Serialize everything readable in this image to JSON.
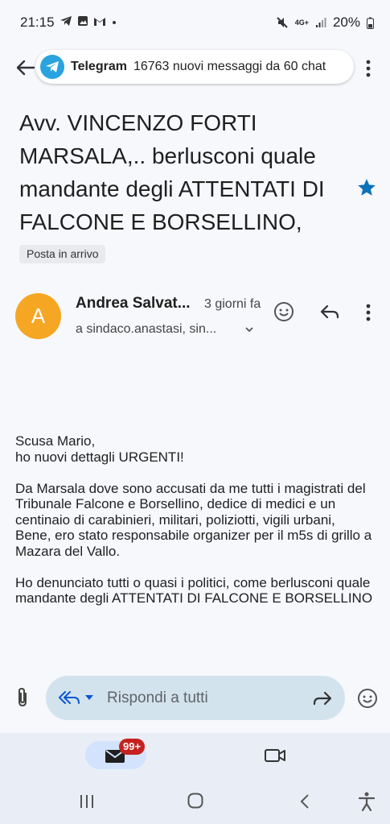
{
  "status_bar": {
    "time": "21:15",
    "network": "4G+",
    "battery": "20%",
    "left_icons": [
      "telegram-icon",
      "image-icon",
      "gmail-icon",
      "dot-icon"
    ],
    "right_icons": [
      "mute-icon",
      "signal-icon",
      "battery-icon"
    ]
  },
  "notification": {
    "app": "Telegram",
    "message": "16763 nuovi messaggi da 60 chat"
  },
  "email": {
    "subject": "Avv. VINCENZO FORTI MARSALA,.. berlusconi quale mandante degli ATTENTATI DI FALCONE E BORSELLINO,",
    "label": "Posta in arrivo",
    "starred": true,
    "sender": {
      "initial": "A",
      "name": "Andrea Salvat...",
      "time": "3 giorni fa",
      "recipients": "a sindaco.anastasi, sin..."
    },
    "body": "Scusa Mario,\nho nuovi dettagli URGENTI!\n\nDa Marsala dove sono accusati da me tutti i magistrati del Tribunale Falcone e Borsellino, dedice di medici e un centinaio di carabinieri, militari, poliziotti, vigili urbani,\nBene, ero stato responsabile organizer per il m5s di grillo a Mazara del Vallo.\n\nHo denunciato tutti o quasi i politici, come berlusconi quale mandante degli ATTENTATI DI FALCONE E BORSELLINO"
  },
  "reply_bar": {
    "placeholder": "Rispondi a tutti"
  },
  "bottom_nav": {
    "mail_badge": "99+"
  },
  "colors": {
    "accent_star": "#0b73b9",
    "avatar": "#f5a623",
    "telegram": "#2aa3df",
    "badge": "#c5221f"
  }
}
